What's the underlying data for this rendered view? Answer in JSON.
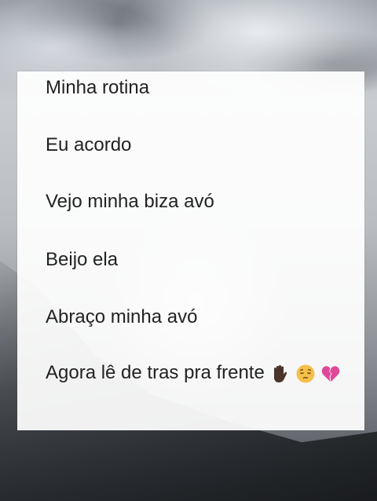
{
  "note": {
    "lines": [
      "Minha rotina",
      "Eu acordo",
      "Vejo minha biza avó",
      "Beijo ela",
      "Abraço minha avó",
      "Agora lê de tras pra frente"
    ],
    "trailing_emojis": [
      "raised-hand-dark-skin",
      "pensive-face",
      "broken-heart"
    ]
  },
  "colors": {
    "text": "#222222",
    "card": "#ffffff",
    "skin": "#4a3328",
    "face": "#f5c04a",
    "heart": "#e0489a"
  }
}
